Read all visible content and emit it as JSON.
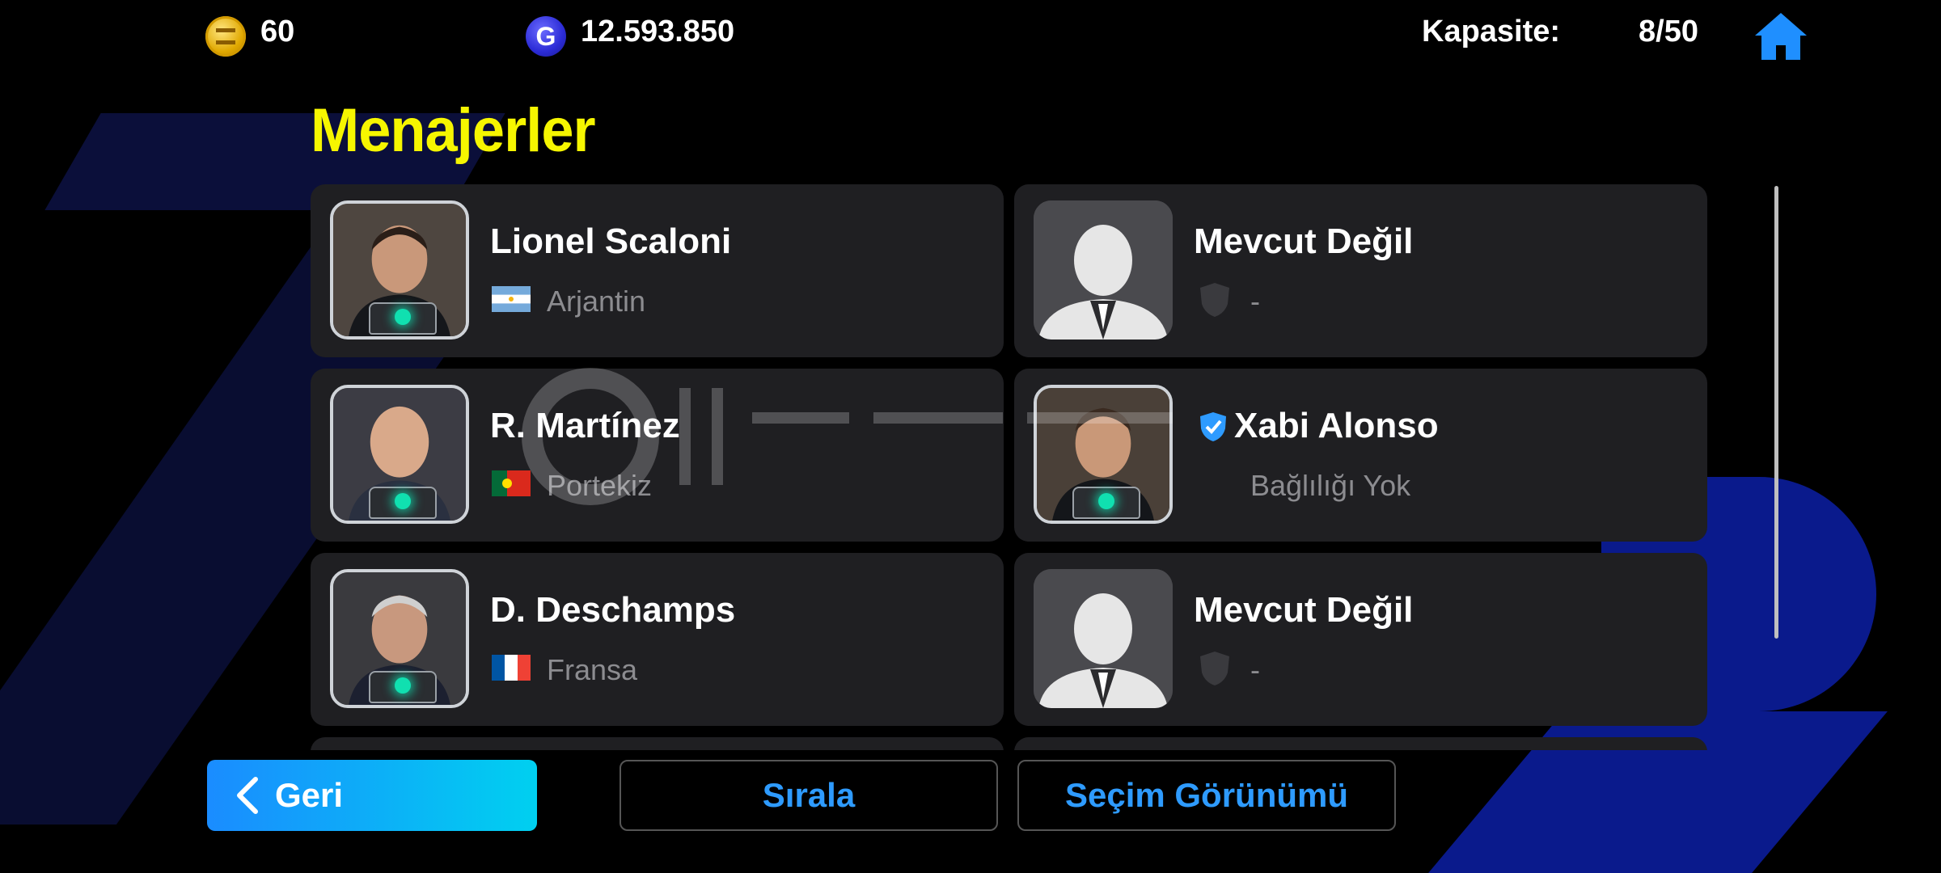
{
  "header": {
    "coins": "60",
    "gp": "12.593.850",
    "gp_icon_letter": "G",
    "capacity_label": "Kapasite:",
    "capacity_value": "8/50"
  },
  "page_title": "Menajerler",
  "managers": [
    {
      "name": "Lionel Scaloni",
      "detail": "Arjantin",
      "flag": "argentina-flag",
      "available": true
    },
    {
      "name": "Mevcut Değil",
      "detail": "-",
      "available": false
    },
    {
      "name": "R. Martínez",
      "detail": "Portekiz",
      "flag": "portugal-flag",
      "available": true
    },
    {
      "name": "Xabi Alonso",
      "detail": "Bağlılığı Yok",
      "verified": true,
      "available": true
    },
    {
      "name": "D. Deschamps",
      "detail": "Fransa",
      "flag": "france-flag",
      "available": true
    },
    {
      "name": "Mevcut Değil",
      "detail": "-",
      "available": false
    }
  ],
  "buttons": {
    "back": "Geri",
    "sort": "Sırala",
    "selection_view": "Seçim Görünümü"
  },
  "colors": {
    "title": "#f6f600",
    "accent_blue": "#2e9bff",
    "card_bg": "#1f1f22",
    "back_gradient_start": "#1a8cff",
    "back_gradient_end": "#00d0f0"
  }
}
